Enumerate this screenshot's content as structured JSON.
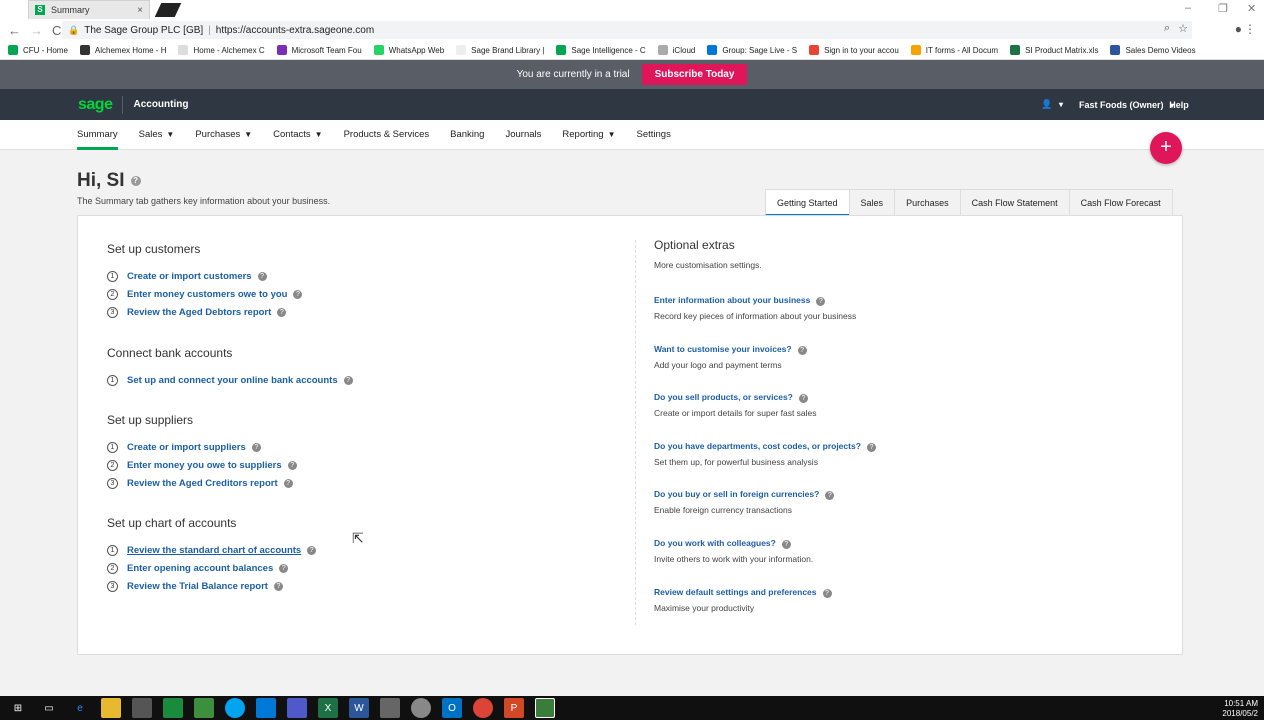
{
  "browser": {
    "tab_title": "Summary",
    "tab_close": "×",
    "nav_back": "←",
    "nav_forward": "→",
    "nav_reload": "C",
    "site_owner": "The Sage Group PLC [GB]",
    "url": "https://accounts-extra.sageone.com",
    "bookmarks": [
      "CFU - Home",
      "Alchemex Home - H",
      "Home - Alchemex C",
      "Microsoft Team Fou",
      "WhatsApp Web",
      "Sage Brand Library |",
      "Sage Intelligence - C",
      "iCloud",
      "Group: Sage Live - S",
      "Sign in to your accou",
      "IT forms - All Docum",
      "SI Product Matrix.xls",
      "Sales Demo Videos"
    ]
  },
  "trial": {
    "text": "You are currently in a trial",
    "button": "Subscribe Today"
  },
  "header": {
    "logo": "sage",
    "app": "Accounting",
    "user_icon": "user-icon",
    "company": "Fast Foods (Owner)",
    "help": "Help"
  },
  "nav": {
    "items": [
      "Summary",
      "Sales",
      "Purchases",
      "Contacts",
      "Products & Services",
      "Banking",
      "Journals",
      "Reporting",
      "Settings"
    ]
  },
  "fab": "+",
  "page": {
    "greeting": "Hi, SI",
    "subtitle": "The Summary tab gathers key information about your business."
  },
  "subtabs": [
    "Getting Started",
    "Sales",
    "Purchases",
    "Cash Flow Statement",
    "Cash Flow Forecast"
  ],
  "sections": [
    {
      "title": "Set up customers",
      "steps": [
        "Create or import customers",
        "Enter money customers owe to you",
        "Review the Aged Debtors report"
      ]
    },
    {
      "title": "Connect bank accounts",
      "steps": [
        "Set up and connect your online bank accounts"
      ]
    },
    {
      "title": "Set up suppliers",
      "steps": [
        "Create or import suppliers",
        "Enter money you owe to suppliers",
        "Review the Aged Creditors report"
      ]
    },
    {
      "title": "Set up chart of accounts",
      "steps": [
        "Review the standard chart of accounts",
        "Enter opening account balances",
        "Review the Trial Balance report"
      ]
    }
  ],
  "step_numbers": [
    "1",
    "2",
    "3"
  ],
  "optional": {
    "title": "Optional extras",
    "desc": "More customisation settings.",
    "items": [
      {
        "link": "Enter information about your business",
        "desc": "Record key pieces of information about your business"
      },
      {
        "link": "Want to customise your invoices?",
        "desc": "Add your logo and payment terms"
      },
      {
        "link": "Do you sell products, or services?",
        "desc": "Create or import details for super fast sales"
      },
      {
        "link": "Do you have departments, cost codes, or projects?",
        "desc": "Set them up, for powerful business analysis"
      },
      {
        "link": "Do you buy or sell in foreign currencies?",
        "desc": "Enable foreign currency transactions"
      },
      {
        "link": "Do you work with colleagues?",
        "desc": "Invite others to work with your information."
      },
      {
        "link": "Review default settings and preferences",
        "desc": "Maximise your productivity"
      }
    ]
  },
  "taskbar": {
    "time": "10:51 AM",
    "date": "2018/05/2"
  }
}
